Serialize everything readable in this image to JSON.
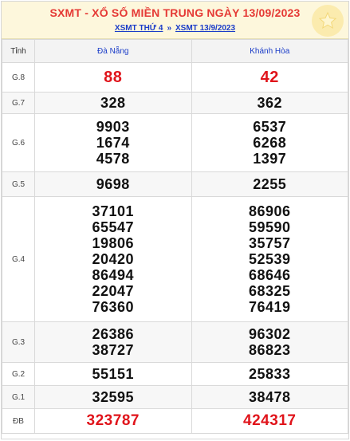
{
  "header": {
    "title": "SXMT - XỔ SỐ MIỀN TRUNG NGÀY 13/09/2023",
    "breadcrumb_1": "XSMT THỨ 4",
    "breadcrumb_sep": "»",
    "breadcrumb_2": "XSMT 13/9/2023"
  },
  "columns": {
    "label": "Tỉnh",
    "province_1": "Đà Nẵng",
    "province_2": "Khánh Hòa"
  },
  "prizes": {
    "g8": {
      "label": "G.8",
      "p1": [
        "88"
      ],
      "p2": [
        "42"
      ]
    },
    "g7": {
      "label": "G.7",
      "p1": [
        "328"
      ],
      "p2": [
        "362"
      ]
    },
    "g6": {
      "label": "G.6",
      "p1": [
        "9903",
        "1674",
        "4578"
      ],
      "p2": [
        "6537",
        "6268",
        "1397"
      ]
    },
    "g5": {
      "label": "G.5",
      "p1": [
        "9698"
      ],
      "p2": [
        "2255"
      ]
    },
    "g4": {
      "label": "G.4",
      "p1": [
        "37101",
        "65547",
        "19806",
        "20420",
        "86494",
        "22047",
        "76360"
      ],
      "p2": [
        "86906",
        "59590",
        "35757",
        "52539",
        "68646",
        "68325",
        "76419"
      ]
    },
    "g3": {
      "label": "G.3",
      "p1": [
        "26386",
        "38727"
      ],
      "p2": [
        "96302",
        "86823"
      ]
    },
    "g2": {
      "label": "G.2",
      "p1": [
        "55151"
      ],
      "p2": [
        "25833"
      ]
    },
    "g1": {
      "label": "G.1",
      "p1": [
        "32595"
      ],
      "p2": [
        "38478"
      ]
    },
    "db": {
      "label": "ĐB",
      "p1": [
        "323787"
      ],
      "p2": [
        "424317"
      ]
    }
  },
  "colors": {
    "title": "#e53935",
    "link": "#1a3cc8",
    "highlight_number": "#e0141b",
    "header_bg": "#fdf7dc"
  },
  "icons": {
    "badge": "star-icon"
  }
}
